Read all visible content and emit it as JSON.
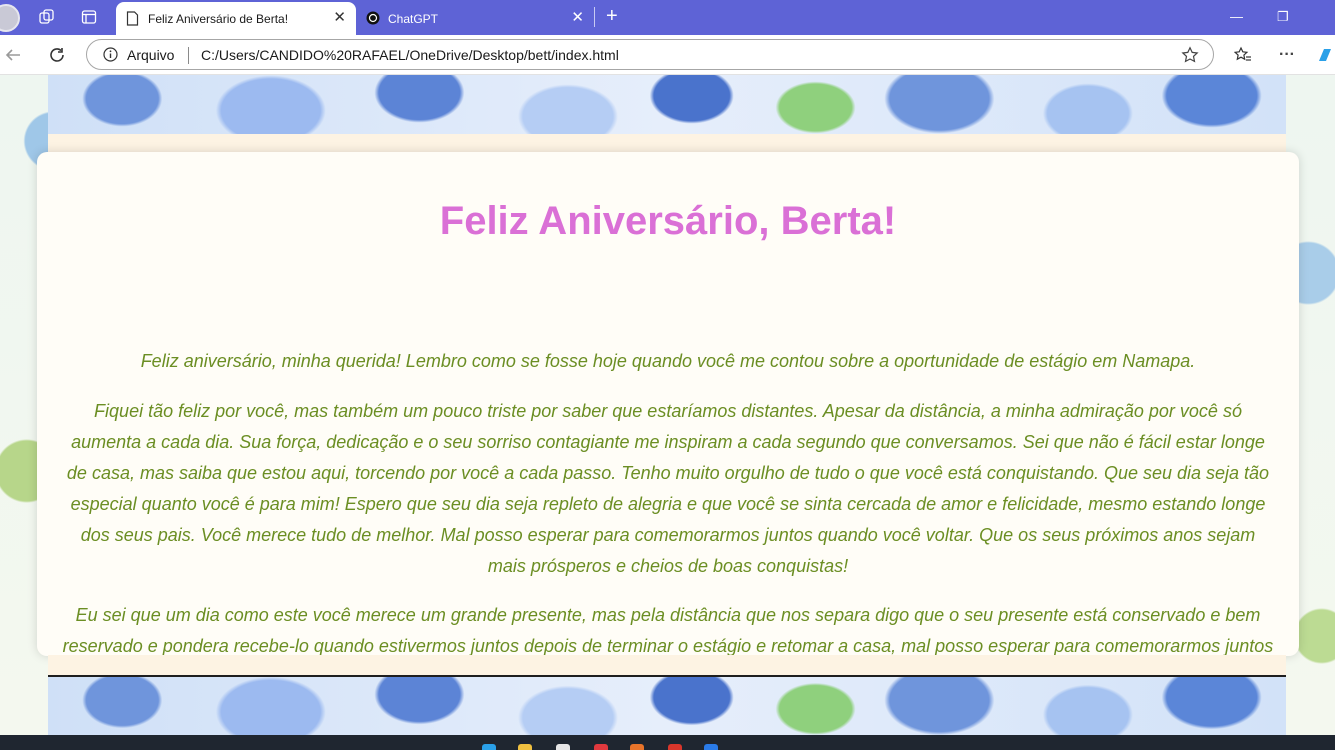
{
  "browser": {
    "tabs": [
      {
        "label": "Feliz Aniversário de Berta!",
        "active": true
      },
      {
        "label": "ChatGPT",
        "active": false
      }
    ],
    "address": {
      "scheme_label": "Arquivo",
      "url": "C:/Users/CANDIDO%20RAFAEL/OneDrive/Desktop/bett/index.html"
    }
  },
  "page": {
    "heading": "Feliz Aniversário, Berta!",
    "paragraphs": [
      "Feliz aniversário, minha querida! Lembro como se fosse hoje quando você me contou sobre a oportunidade de estágio em Namapa.",
      "Fiquei tão feliz por você, mas também um pouco triste por saber que estaríamos distantes. Apesar da distância, a minha admiração por você só aumenta a cada dia. Sua força, dedicação e o seu sorriso contagiante me inspiram a cada segundo que conversamos. Sei que não é fácil estar longe de casa, mas saiba que estou aqui, torcendo por você a cada passo. Tenho muito orgulho de tudo o que você está conquistando. Que seu dia seja tão especial quanto você é para mim! Espero que seu dia seja repleto de alegria e que você se sinta cercada de amor e felicidade, mesmo estando longe dos seus pais. Você merece tudo de melhor. Mal posso esperar para comemorarmos juntos quando você voltar. Que os seus próximos anos sejam mais prósperos e cheios de boas conquistas!",
      "Eu sei que um dia como este você merece um grande presente, mas pela distância que nos separa digo que o seu presente está conservado e bem reservado e pondera recebe-lo quando estivermos juntos depois de terminar o estágio e retomar a casa, mal posso esperar para comemorarmos juntos quando você voltar."
    ]
  },
  "colors": {
    "titlebar": "#5e63d6",
    "heading": "#da70d6",
    "body_text": "#6b8e23",
    "card": "#fffdf7"
  },
  "icons": [
    "profile-avatar-icon",
    "workspaces-icon",
    "tab-actions-icon",
    "page-favicon",
    "chatgpt-favicon",
    "close-icon",
    "new-tab-icon",
    "minimize-icon",
    "maximize-icon",
    "back-icon",
    "refresh-icon",
    "info-icon",
    "favorite-star-icon",
    "favorites-icon",
    "more-icon"
  ]
}
